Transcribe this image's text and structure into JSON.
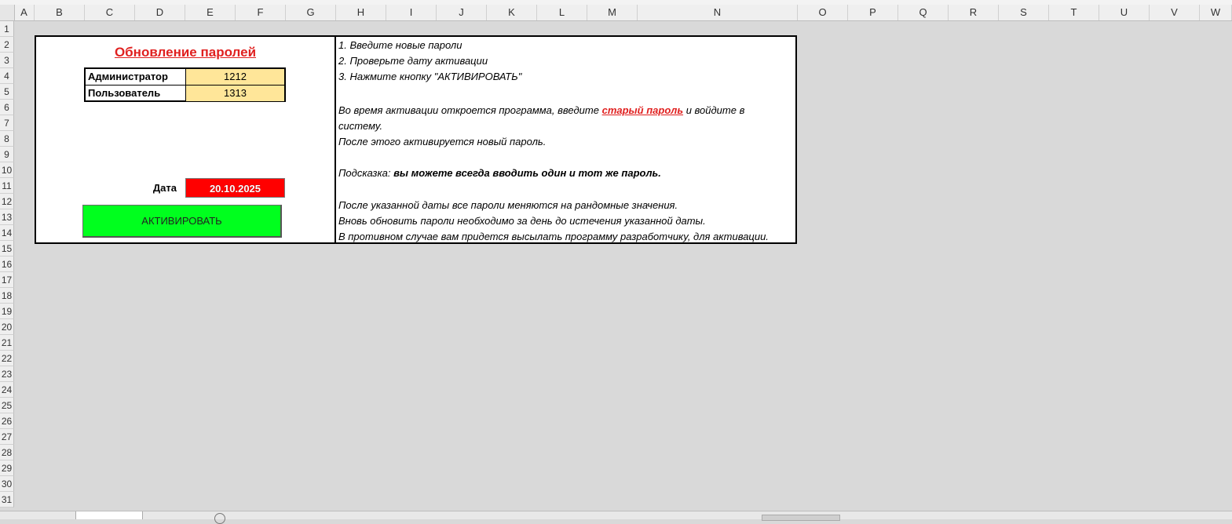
{
  "columns": [
    "A",
    "B",
    "C",
    "D",
    "E",
    "F",
    "G",
    "H",
    "I",
    "J",
    "K",
    "L",
    "M",
    "N",
    "O",
    "P",
    "Q",
    "R",
    "S",
    "T",
    "U",
    "V",
    "W"
  ],
  "rows": [
    "1",
    "2",
    "3",
    "4",
    "5",
    "6",
    "7",
    "8",
    "9",
    "10",
    "11",
    "12",
    "13",
    "14",
    "15",
    "16",
    "17",
    "18",
    "19",
    "20",
    "21",
    "22",
    "23",
    "24",
    "25",
    "26",
    "27",
    "28",
    "29",
    "30",
    "31"
  ],
  "panel": {
    "title": "Обновление паролей",
    "passwords": [
      {
        "label": "Администратор",
        "value": "1212"
      },
      {
        "label": "Пользователь",
        "value": "1313"
      }
    ],
    "date_label": "Дата",
    "date_value": "20.10.2025",
    "activate_label": "АКТИВИРОВАТЬ",
    "colors": {
      "title": "#e0201f",
      "value_fill": "#ffe699",
      "date_fill": "#ff0000",
      "button_fill": "#00ff1e"
    }
  },
  "instructions": {
    "step1": "1. Введите новые пароли",
    "step2": "2. Проверьте дату активации",
    "step3": "3. Нажмите кнопку \"АКТИВИРОВАТЬ\"",
    "line6_pre": "Во время активации откроется программа, введите ",
    "line6_red": "старый пароль",
    "line6_post": " и войдите в",
    "line7": "систему.",
    "line8": "После этого активируется новый пароль.",
    "hint_label": "Подсказка: ",
    "hint_text": " вы можете всегда вводить один и тот же пароль.",
    "line12": "После указанной даты все пароли меняются на рандомные значения.",
    "line13": "Вновь обновить пароли необходимо за день до истечения указанной даты.",
    "line14": "В противном случае вам придется высылать программу разработчику, для активации."
  }
}
